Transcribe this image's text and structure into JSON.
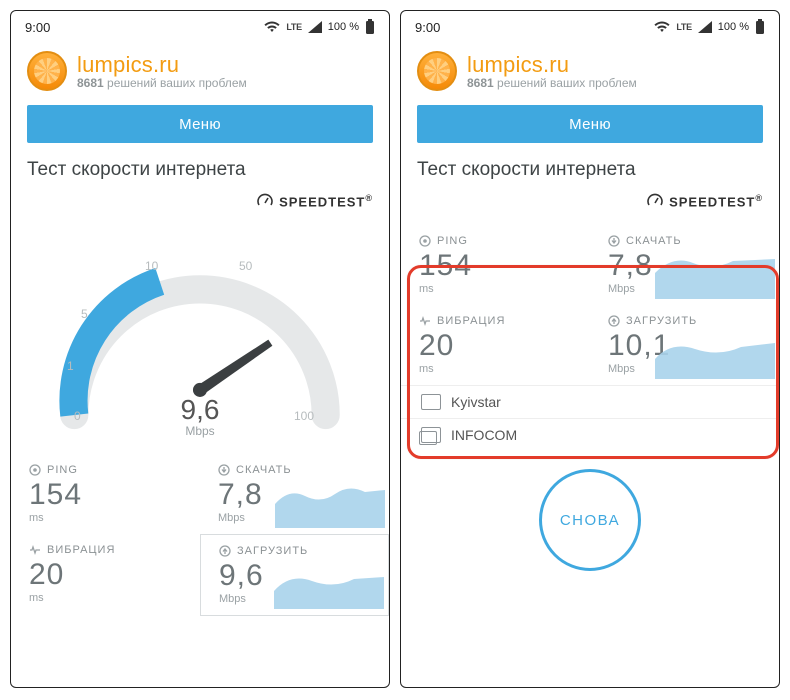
{
  "status": {
    "time": "9:00",
    "lte": "LTE",
    "battery": "100 %"
  },
  "brand": {
    "name": "lumpics.ru",
    "count": "8681",
    "tagline_rest": " решений ваших проблем"
  },
  "menu_label": "Меню",
  "page_title": "Тест скорости интернета",
  "speedtest_label": "SPEEDTEST",
  "gauge": {
    "value": "9,6",
    "unit": "Mbps",
    "ticks": {
      "t0": "0",
      "t1": "1",
      "t5": "5",
      "t10": "10",
      "t50": "50",
      "t100": "100"
    }
  },
  "metrics": {
    "ping": {
      "label": "PING",
      "value": "154",
      "unit": "ms"
    },
    "download": {
      "label": "СКАЧАТЬ",
      "value": "7,8",
      "unit": "Mbps"
    },
    "jitter": {
      "label": "ВИБРАЦИЯ",
      "value": "20",
      "unit": "ms"
    },
    "upload_left": {
      "label": "ЗАГРУЗИТЬ",
      "value": "9,6",
      "unit": "Mbps"
    },
    "upload_right": {
      "label": "ЗАГРУЗИТЬ",
      "value": "10,1",
      "unit": "Mbps"
    }
  },
  "providers": {
    "isp": "Kyivstar",
    "server": "INFOCOM"
  },
  "again_label": "СНОВА"
}
